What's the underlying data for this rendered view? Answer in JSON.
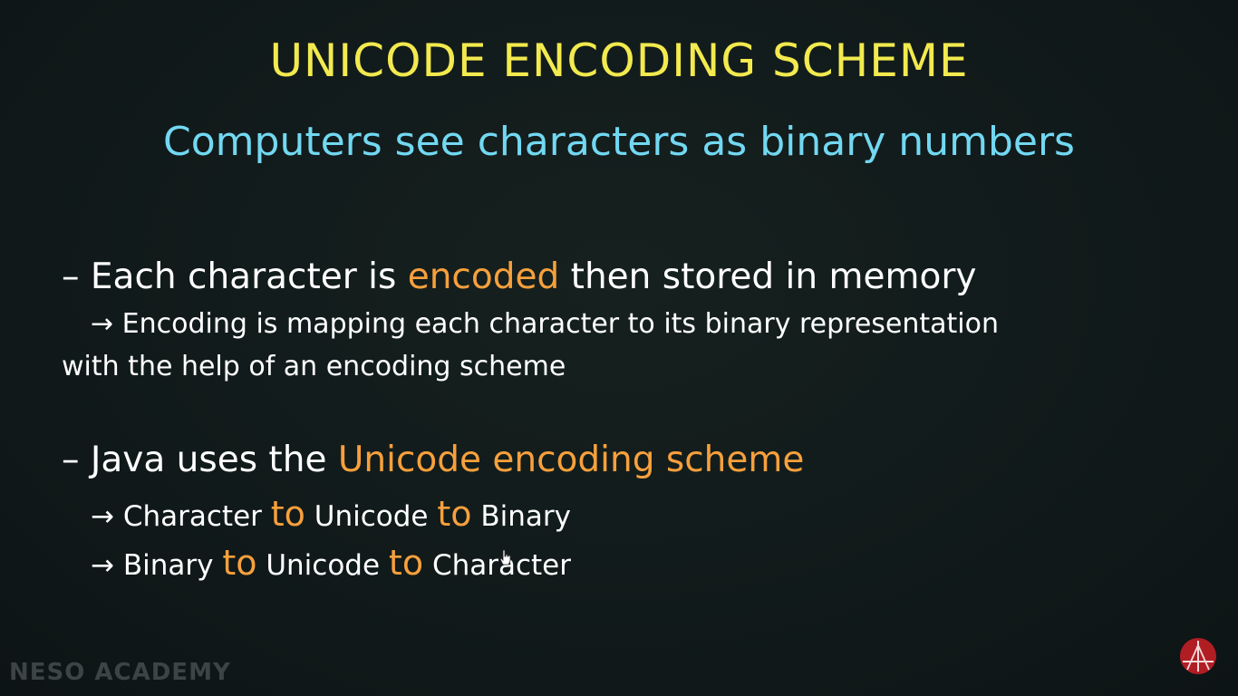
{
  "slide": {
    "title": "UNICODE ENCODING SCHEME",
    "subtitle": "Computers see characters as binary numbers",
    "bullet1": {
      "dash": "– ",
      "before": "Each character is ",
      "highlight": "encoded",
      "after": " then stored in memory",
      "sub_line1": "→ Encoding is mapping each character to its binary representation",
      "sub_line2": "with the help of an encoding scheme"
    },
    "bullet2": {
      "dash": "– ",
      "before": "Java uses the ",
      "highlight": "Unicode encoding scheme",
      "sub1": {
        "arrow": "→ ",
        "a": "Character",
        "to1": "to",
        "b": "Unicode",
        "to2": "to",
        "c": "Binary"
      },
      "sub2": {
        "arrow": "→ ",
        "a": "Binary",
        "to1": "to",
        "b": "Unicode",
        "to2": "to",
        "c": "Character"
      }
    }
  },
  "watermark": "NESO ACADEMY",
  "logo_icon": "neso-academy-logo-icon",
  "colors": {
    "background": "#111b1c",
    "title": "#f2ea4e",
    "subtitle": "#72d8f2",
    "highlight": "#f7a03c",
    "text": "#ffffff",
    "logo": "#b01e24"
  }
}
